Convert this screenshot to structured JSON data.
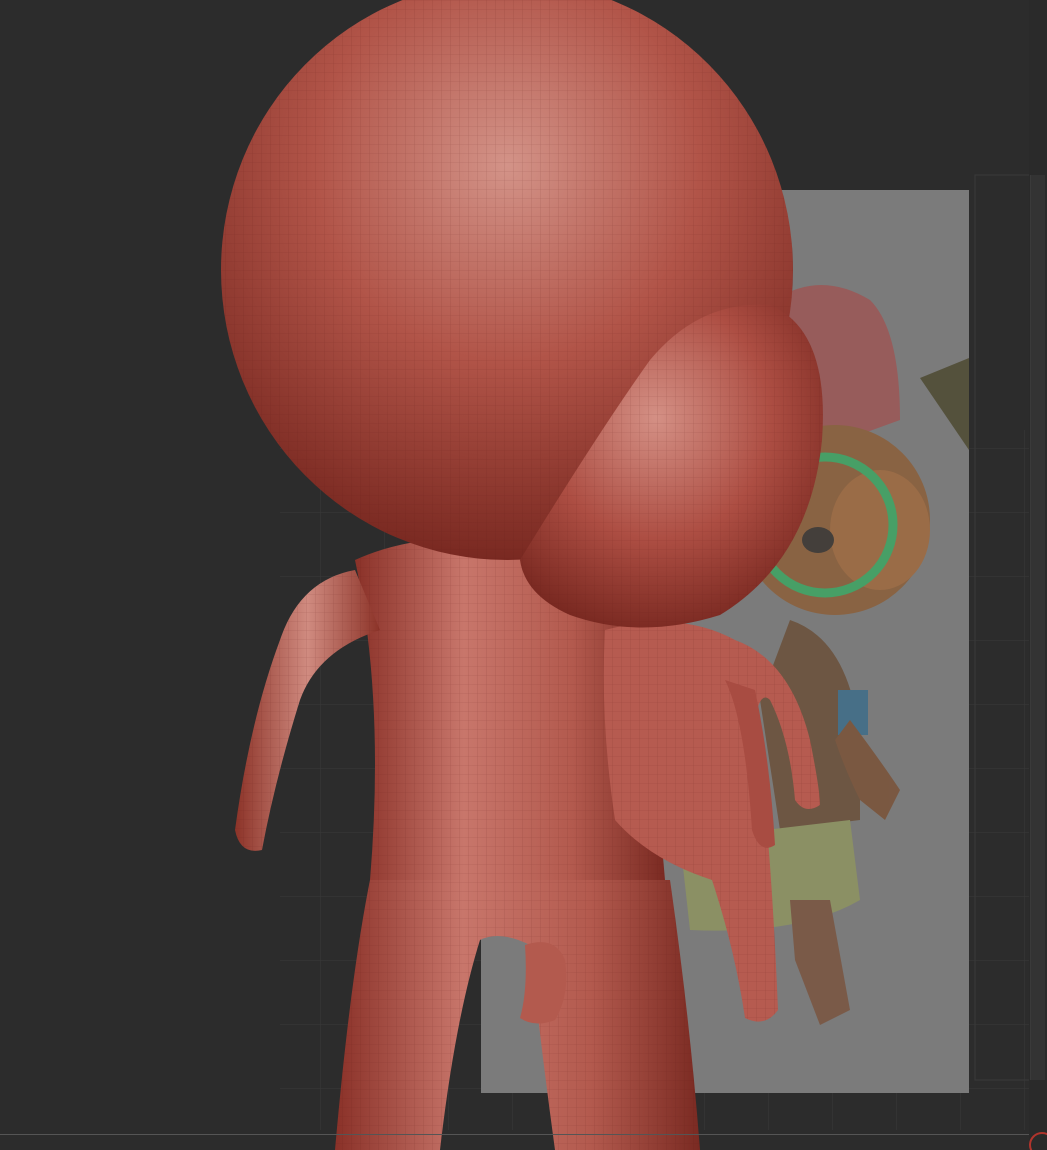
{
  "app": {
    "viewport_label": "",
    "background_color": "#2c2c2c"
  },
  "colors": {
    "clay": "#b5564a",
    "clay_dark": "#7d2b24",
    "clay_light": "#d88a80",
    "reference_panel": "#7b7b7b",
    "grid_line": "#3a3a3a"
  },
  "scene": {
    "model": "chibi-clay-figure",
    "reference": "character-reference-image"
  }
}
